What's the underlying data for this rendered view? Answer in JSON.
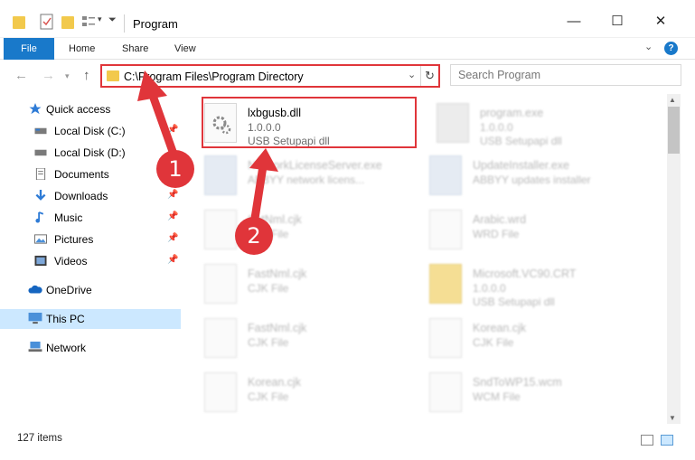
{
  "window": {
    "title": "Program"
  },
  "ribbon": {
    "tabs": [
      "File",
      "Home",
      "Share",
      "View"
    ],
    "help": "?"
  },
  "nav": {
    "address": "C:\\Program Files\\Program Directory",
    "search_placeholder": "Search Program"
  },
  "sidebar": {
    "items": [
      {
        "label": "Quick access"
      },
      {
        "label": "Local Disk (C:)"
      },
      {
        "label": "Local Disk (D:)"
      },
      {
        "label": "Documents"
      },
      {
        "label": "Downloads"
      },
      {
        "label": "Music"
      },
      {
        "label": "Pictures"
      },
      {
        "label": "Videos"
      },
      {
        "label": "OneDrive"
      },
      {
        "label": "This PC"
      },
      {
        "label": "Network"
      }
    ]
  },
  "files": [
    {
      "name": "lxbgusb.dll",
      "line2": "1.0.0.0",
      "line3": "USB Setupapi dll"
    },
    {
      "name": "program.exe",
      "line2": "1.0.0.0",
      "line3": "USB Setupapi dll"
    },
    {
      "name": "NetworkLicenseServer.exe",
      "line2": "ABBYY network licens..."
    },
    {
      "name": "UpdateInstaller.exe",
      "line2": "ABBYY updates installer"
    },
    {
      "name": "SetNml.cjk",
      "line2": "CJK File"
    },
    {
      "name": "Arabic.wrd",
      "line2": "WRD File"
    },
    {
      "name": "FastNml.cjk",
      "line2": "CJK File"
    },
    {
      "name": "Microsoft.VC90.CRT",
      "line2": "1.0.0.0",
      "line3": "USB Setupapi dll"
    },
    {
      "name": "FastNml.cjk",
      "line2": "CJK File"
    },
    {
      "name": "Korean.cjk",
      "line2": "CJK File"
    },
    {
      "name": "Korean.cjk",
      "line2": "CJK File"
    },
    {
      "name": "SndToWP15.wcm",
      "line2": "WCM File"
    }
  ],
  "status": {
    "items": "127 items"
  },
  "annotations": {
    "step1": "1",
    "step2": "2"
  },
  "colors": {
    "accent": "#1979ca",
    "highlight": "#e0353a",
    "selection": "#cce8ff"
  }
}
